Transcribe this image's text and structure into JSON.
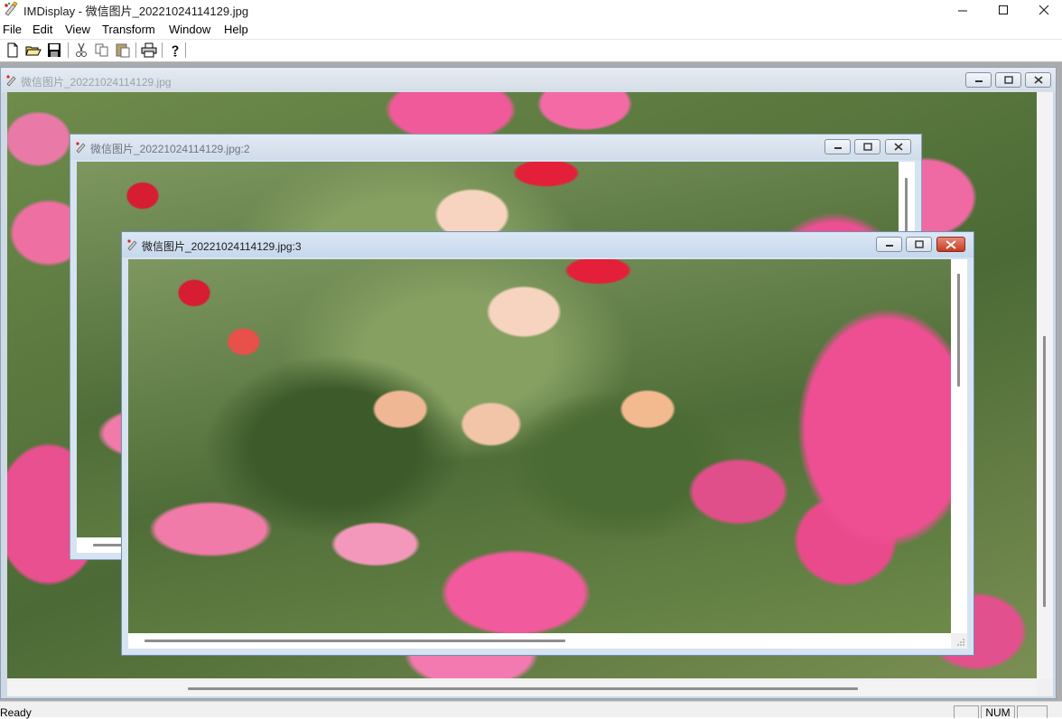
{
  "window": {
    "title": "IMDisplay - 微信图片_20221024114129.jpg"
  },
  "menu": {
    "items": [
      "File",
      "Edit",
      "View",
      "Transform",
      "Window",
      "Help"
    ]
  },
  "toolbar": {
    "buttons": [
      "new-icon",
      "open-icon",
      "save-icon",
      "cut-icon",
      "copy-icon",
      "paste-icon",
      "print-icon",
      "help-icon"
    ]
  },
  "children": [
    {
      "title": "微信图片_20221024114129.jpg"
    },
    {
      "title": "微信图片_20221024114129.jpg:2"
    },
    {
      "title": "微信图片_20221024114129.jpg:3"
    }
  ],
  "statusbar": {
    "text": "Ready",
    "num": "NUM"
  },
  "colors": {
    "caption_active": "#dfeaf6",
    "close_active": "#c73a20",
    "mdi_background": "#ababab"
  }
}
